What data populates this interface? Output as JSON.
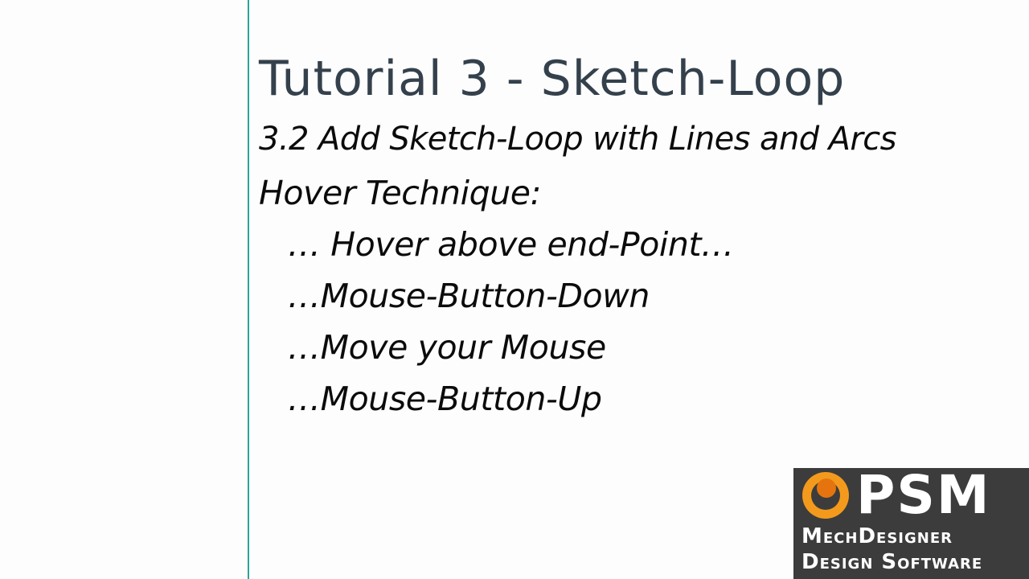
{
  "slide": {
    "title": "Tutorial 3 - Sketch-Loop",
    "subtitle": "3.2 Add Sketch-Loop with Lines and Arcs",
    "heading": "Hover Technique:",
    "steps": [
      "… Hover above end-Point…",
      "…Mouse-Button-Down",
      "…Move your Mouse",
      "…Mouse-Button-Up"
    ]
  },
  "logo": {
    "brand": "PSM",
    "line1": "MechDesigner",
    "line2": "Design Software",
    "colors": {
      "background": "#3c3c3c",
      "orange": "#f39a1d",
      "text": "#ffffff"
    }
  },
  "colors": {
    "divider": "#2aa59a",
    "title": "#34414c",
    "body": "#0b0b0b",
    "background": "#fdfdfd"
  }
}
